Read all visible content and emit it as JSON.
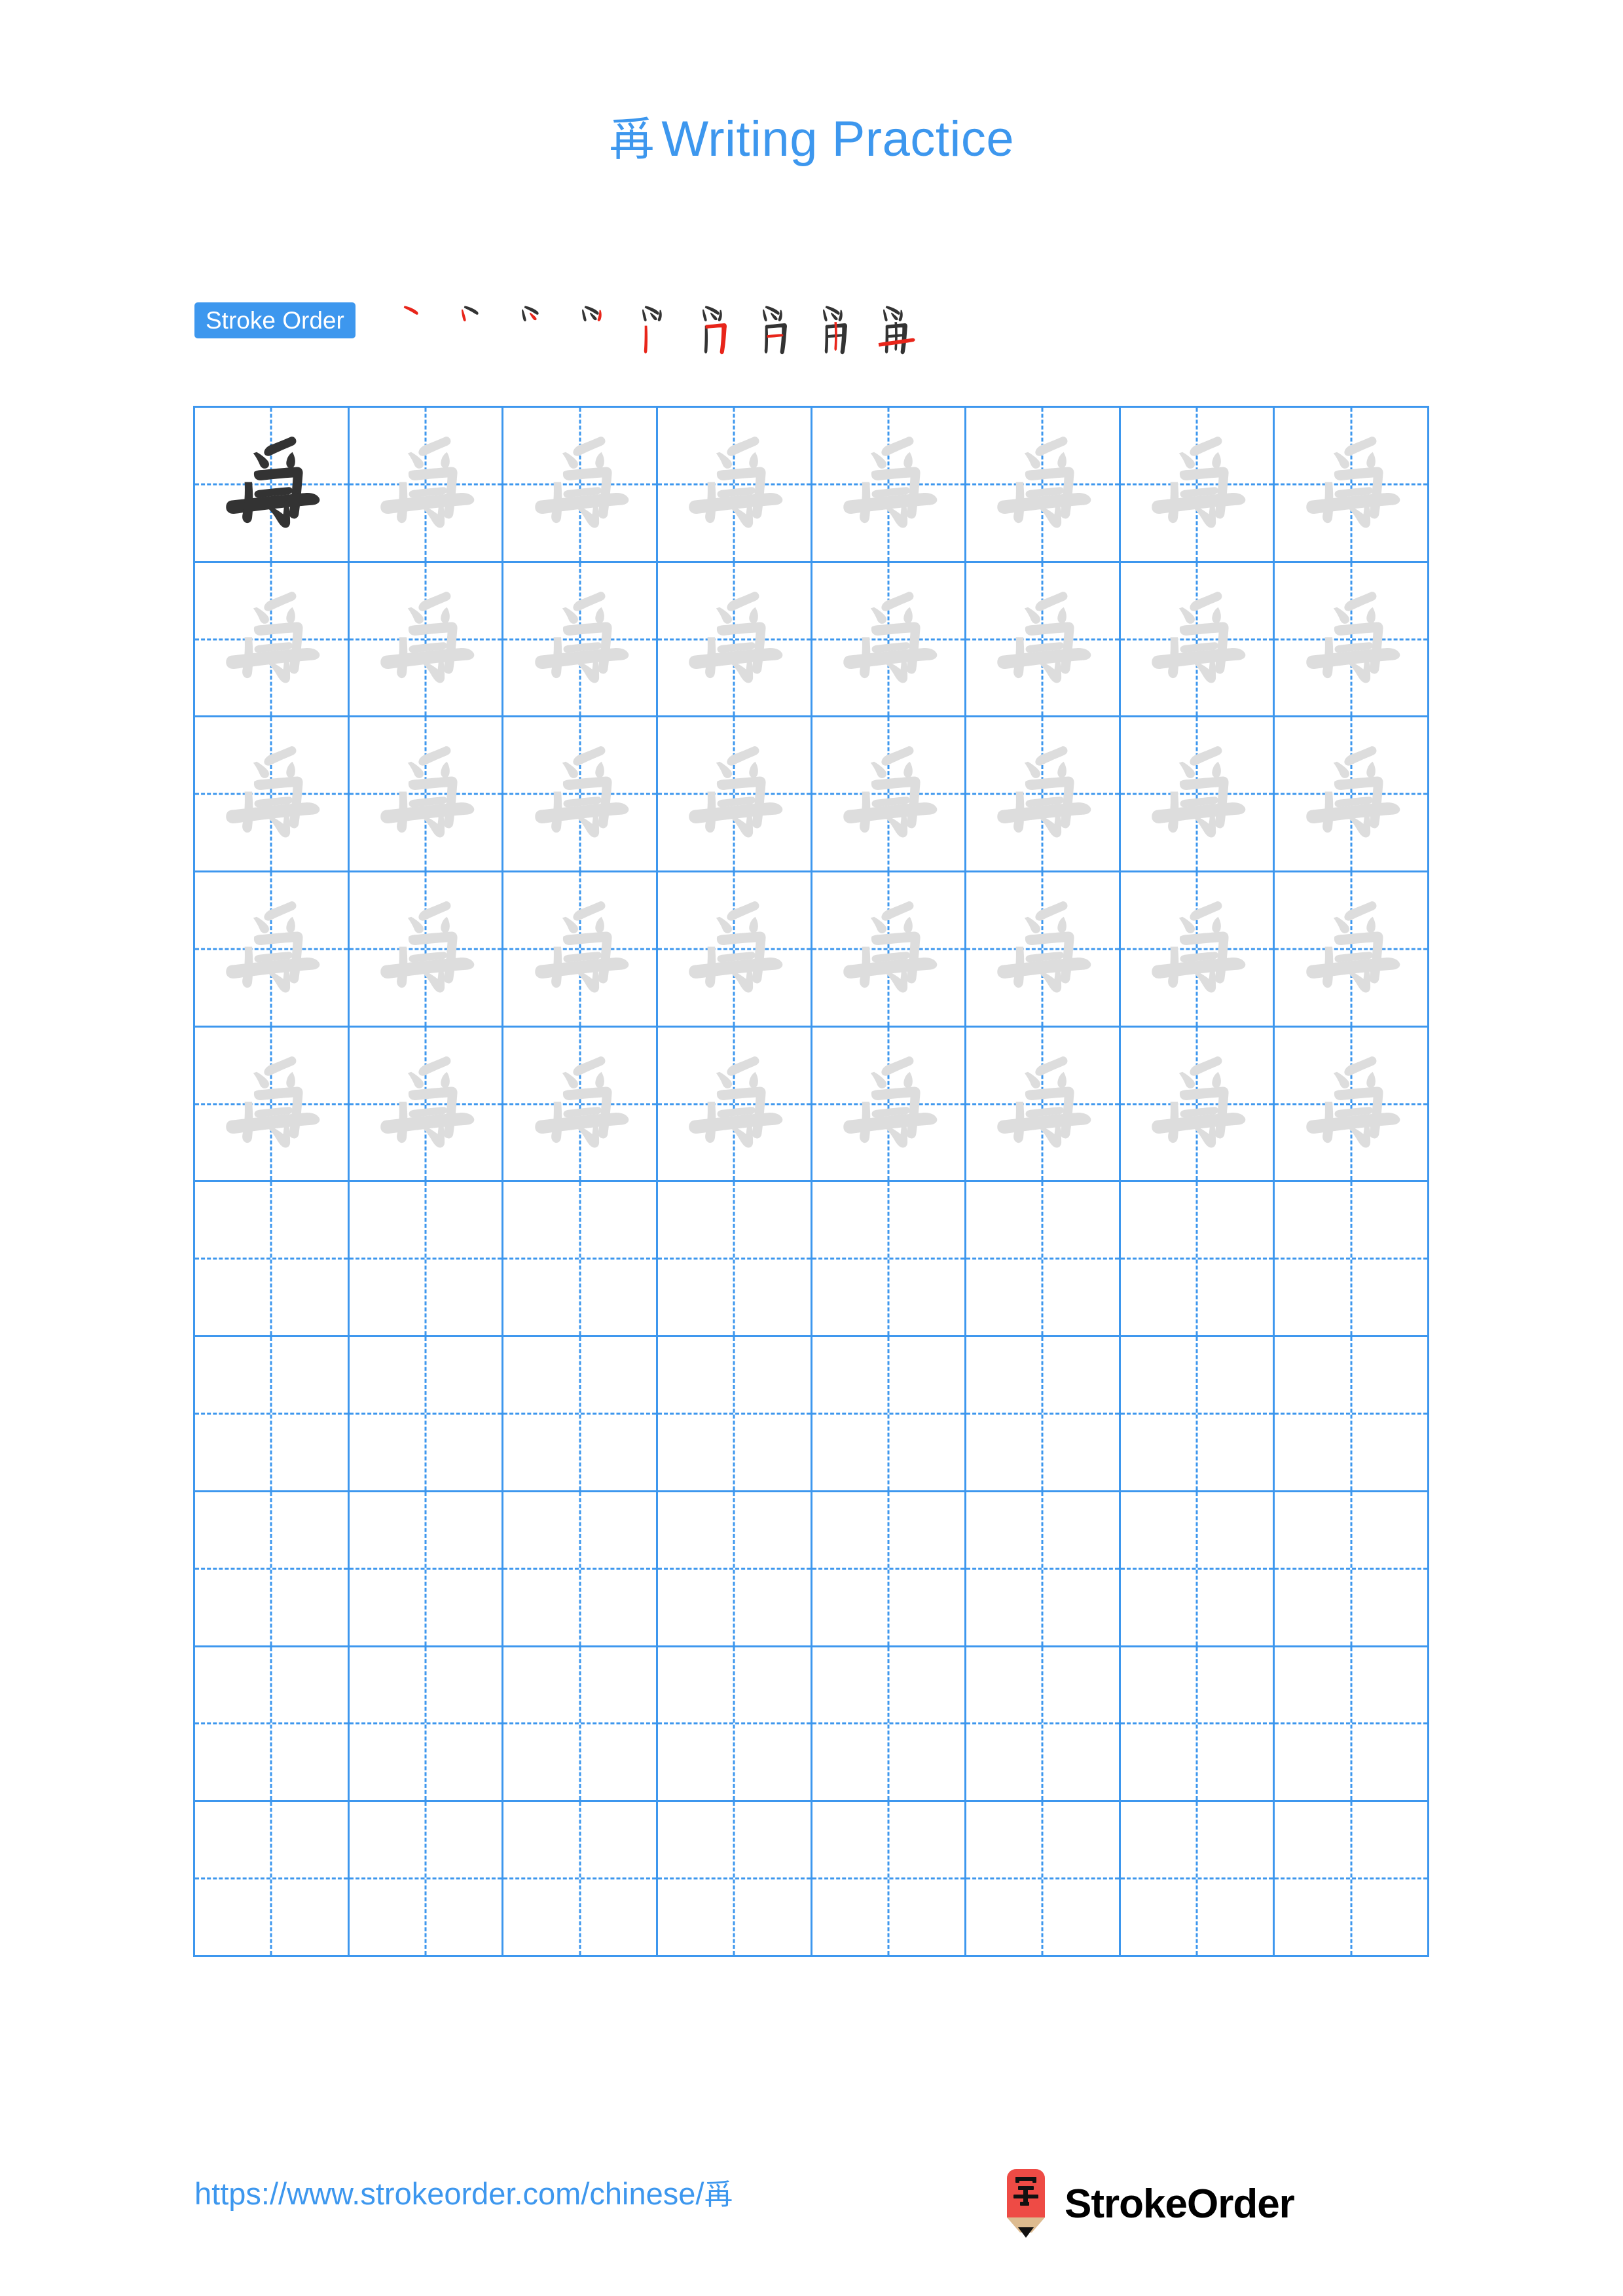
{
  "page": {
    "character": "爯",
    "title_suffix": "Writing Practice",
    "background_color": "#ffffff",
    "accent_color": "#3d97ee"
  },
  "header": {
    "title_character": "爯",
    "title_text": "Writing Practice"
  },
  "stroke_order": {
    "badge_label": "Stroke Order",
    "badge_background": "#3d97ee",
    "badge_text_color": "#ffffff",
    "total_strokes": 9,
    "new_stroke_color": "#e8251a",
    "existing_stroke_color": "#333333",
    "steps": [
      {
        "index": 1,
        "strokes_shown": 1,
        "new_stroke": 1
      },
      {
        "index": 2,
        "strokes_shown": 2,
        "new_stroke": 2
      },
      {
        "index": 3,
        "strokes_shown": 3,
        "new_stroke": 3
      },
      {
        "index": 4,
        "strokes_shown": 4,
        "new_stroke": 4
      },
      {
        "index": 5,
        "strokes_shown": 5,
        "new_stroke": 5
      },
      {
        "index": 6,
        "strokes_shown": 6,
        "new_stroke": 6
      },
      {
        "index": 7,
        "strokes_shown": 7,
        "new_stroke": 7
      },
      {
        "index": 8,
        "strokes_shown": 8,
        "new_stroke": 8
      },
      {
        "index": 9,
        "strokes_shown": 9,
        "new_stroke": 9
      }
    ]
  },
  "practice_grid": {
    "columns": 8,
    "rows": 10,
    "grid_line_color": "#3d97ee",
    "traced_character": "爯",
    "dark_glyph_color": "#333333",
    "light_glyph_color": "#dddddd",
    "cells": [
      [
        "dark",
        "light",
        "light",
        "light",
        "light",
        "light",
        "light",
        "light"
      ],
      [
        "light",
        "light",
        "light",
        "light",
        "light",
        "light",
        "light",
        "light"
      ],
      [
        "light",
        "light",
        "light",
        "light",
        "light",
        "light",
        "light",
        "light"
      ],
      [
        "light",
        "light",
        "light",
        "light",
        "light",
        "light",
        "light",
        "light"
      ],
      [
        "light",
        "light",
        "light",
        "light",
        "light",
        "light",
        "light",
        "light"
      ],
      [
        "empty",
        "empty",
        "empty",
        "empty",
        "empty",
        "empty",
        "empty",
        "empty"
      ],
      [
        "empty",
        "empty",
        "empty",
        "empty",
        "empty",
        "empty",
        "empty",
        "empty"
      ],
      [
        "empty",
        "empty",
        "empty",
        "empty",
        "empty",
        "empty",
        "empty",
        "empty"
      ],
      [
        "empty",
        "empty",
        "empty",
        "empty",
        "empty",
        "empty",
        "empty",
        "empty"
      ],
      [
        "empty",
        "empty",
        "empty",
        "empty",
        "empty",
        "empty",
        "empty",
        "empty"
      ]
    ]
  },
  "footer": {
    "url_text": "https://www.strokeorder.com/chinese/",
    "url_character": "爯",
    "url_color": "#3d97ee",
    "brand_name": "StrokeOrder",
    "logo_character": "字",
    "logo_body_color": "#ee4b45",
    "logo_wood_color": "#ddbb8f",
    "logo_tip_color": "#111111"
  }
}
